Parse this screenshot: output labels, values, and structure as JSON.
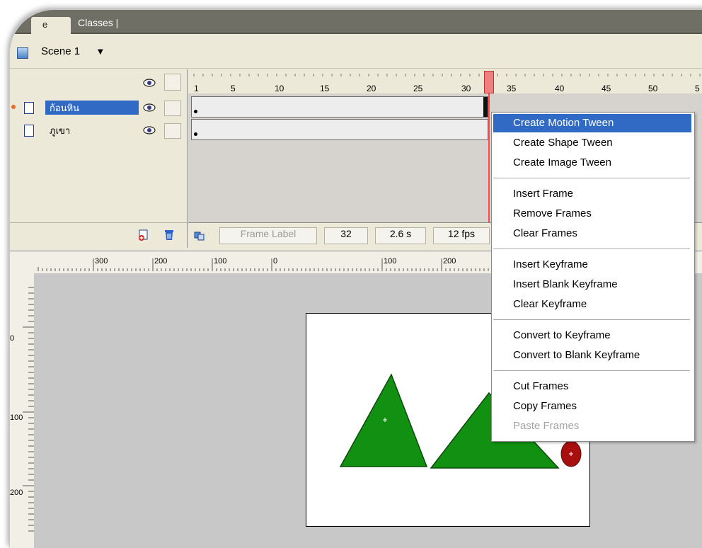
{
  "tabs": {
    "scene_tab": "e",
    "classes_tab": "Classes |"
  },
  "scene": {
    "label": "Scene 1"
  },
  "layers": [
    {
      "name": "ก้อนหิน",
      "selected": true
    },
    {
      "name": "ภูเขา",
      "selected": false
    }
  ],
  "ruler": {
    "ticks": [
      "1",
      "5",
      "10",
      "15",
      "20",
      "25",
      "30",
      "35",
      "40",
      "45",
      "50",
      "5"
    ]
  },
  "timeline_footer": {
    "frame_label_placeholder": "Frame Label",
    "current_frame": "32",
    "elapsed_time": "2.6 s",
    "frame_rate": "12 fps"
  },
  "stage_ruler": {
    "horizontal": [
      "300",
      "200",
      "100",
      "0",
      "100",
      "200"
    ],
    "vertical": [
      "0",
      "100",
      "200"
    ]
  },
  "context_menu": {
    "group1": [
      "Create Motion Tween",
      "Create Shape Tween",
      "Create Image Tween"
    ],
    "group2": [
      "Insert Frame",
      "Remove Frames",
      "Clear Frames"
    ],
    "group3": [
      "Insert Keyframe",
      "Insert Blank Keyframe",
      "Clear Keyframe"
    ],
    "group4": [
      "Convert to Keyframe",
      "Convert to Blank Keyframe"
    ],
    "group5": [
      "Cut Frames",
      "Copy Frames",
      "Paste Frames"
    ],
    "highlighted": "Create Motion Tween",
    "disabled": "Paste Frames"
  },
  "colors": {
    "selection": "#316ac5",
    "playhead": "#ff4a4a",
    "triangle_fill": "#119011",
    "circle_fill": "#a80f0f"
  }
}
